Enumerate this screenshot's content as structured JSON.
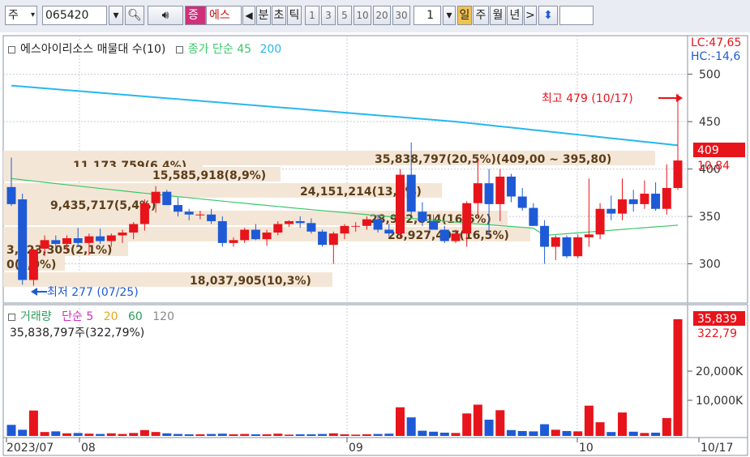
{
  "toolbar": {
    "period_select": "주",
    "code": "065420",
    "stock_badge": "증",
    "stock_name": "에스",
    "nav_left": "◀",
    "buttons": [
      "분",
      "초",
      "틱"
    ],
    "intervals": [
      "1",
      "3",
      "5",
      "10",
      "20",
      "30"
    ],
    "count": "1",
    "tf_buttons": [
      "일",
      "주",
      "월",
      "년"
    ],
    "nav_right": ">",
    "updown": "⬍"
  },
  "price_legend": {
    "name": "에스아이리소스 매물대 수(10)",
    "ma_label": "종가 단순 45",
    "ma_value": "200"
  },
  "right_top": {
    "lc": "LC:47,65",
    "hc": "HC:-14,6"
  },
  "y_axis": {
    "ticks": [
      "500",
      "450",
      "400",
      "350",
      "300"
    ]
  },
  "current_price": {
    "value": "409",
    "change": "10,84"
  },
  "annotations": {
    "high": "최고 479 (10/17)",
    "low": "최저 277 (07/25)"
  },
  "volume_profile": [
    {
      "label": "35,838,797(20,5%)(409,00 ~ 395,80)"
    },
    {
      "label": "11,173,759(6,4%)"
    },
    {
      "label": "15,585,918(8,9%)"
    },
    {
      "label": "24,151,214(13,8%)"
    },
    {
      "label": "9,435,717(5,4%)"
    },
    {
      "label": "28,952,814(16,6%)"
    },
    {
      "label": "28,927,407(16,5%)"
    },
    {
      "label": "3,723,305(2,1%)"
    },
    {
      "label": "0(0,0%)"
    },
    {
      "label": "18,037,905(10,3%)"
    }
  ],
  "volume_legend": {
    "name": "거래량",
    "ma_label": "단순",
    "ma_values": [
      "5",
      "20",
      "60",
      "120"
    ],
    "current": "35,838,797주(322,79%)"
  },
  "vol_axis": {
    "ticks": [
      "20,000K",
      "10,000K"
    ],
    "current": "35,839",
    "pct": "322,79"
  },
  "x_axis": {
    "labels": [
      "2023/07",
      "08",
      "09",
      "10",
      "10/17"
    ]
  },
  "colors": {
    "up": "#e8141b",
    "down": "#1e5ad6",
    "ma": "#39c86a",
    "ma200": "#27b7ee",
    "profile": "#f4e6d6"
  },
  "chart_data": {
    "type": "candlestick",
    "x": [
      "07/17",
      "07/18",
      "07/19",
      "07/20",
      "07/21",
      "07/24",
      "07/25",
      "07/26",
      "07/27",
      "07/28",
      "07/31",
      "08/01",
      "08/02",
      "08/03",
      "08/04",
      "08/07",
      "08/08",
      "08/09",
      "08/10",
      "08/11",
      "08/14",
      "08/16",
      "08/17",
      "08/18",
      "08/21",
      "08/22",
      "08/23",
      "08/24",
      "08/25",
      "08/28",
      "08/29",
      "08/30",
      "08/31",
      "09/01",
      "09/04",
      "09/05",
      "09/06",
      "09/07",
      "09/08",
      "09/11",
      "09/12",
      "09/13",
      "09/14",
      "09/15",
      "09/18",
      "09/19",
      "09/20",
      "09/21",
      "09/22",
      "09/25",
      "09/26",
      "09/27",
      "10/04",
      "10/05",
      "10/06",
      "10/10",
      "10/11",
      "10/12",
      "10/13",
      "10/16",
      "10/17"
    ],
    "ohlc": [
      [
        381,
        412,
        361,
        363
      ],
      [
        368,
        374,
        278,
        283
      ],
      [
        283,
        316,
        277,
        315
      ],
      [
        316,
        330,
        308,
        325
      ],
      [
        325,
        330,
        316,
        321
      ],
      [
        321,
        330,
        314,
        327
      ],
      [
        327,
        338,
        318,
        322
      ],
      [
        322,
        332,
        309,
        329
      ],
      [
        329,
        337,
        321,
        324
      ],
      [
        324,
        332,
        318,
        330
      ],
      [
        330,
        336,
        322,
        333
      ],
      [
        333,
        344,
        326,
        342
      ],
      [
        342,
        368,
        335,
        364
      ],
      [
        364,
        382,
        354,
        376
      ],
      [
        376,
        378,
        362,
        362
      ],
      [
        362,
        370,
        350,
        355
      ],
      [
        355,
        358,
        346,
        352
      ],
      [
        352,
        356,
        347,
        352
      ],
      [
        352,
        358,
        342,
        345
      ],
      [
        345,
        350,
        318,
        322
      ],
      [
        322,
        328,
        318,
        325
      ],
      [
        325,
        338,
        322,
        336
      ],
      [
        336,
        342,
        325,
        326
      ],
      [
        326,
        336,
        319,
        333
      ],
      [
        333,
        345,
        330,
        342
      ],
      [
        342,
        346,
        339,
        345
      ],
      [
        345,
        350,
        338,
        343
      ],
      [
        343,
        348,
        332,
        334
      ],
      [
        334,
        336,
        318,
        320
      ],
      [
        320,
        334,
        300,
        332
      ],
      [
        332,
        342,
        326,
        340
      ],
      [
        340,
        344,
        334,
        340
      ],
      [
        340,
        350,
        336,
        347
      ],
      [
        347,
        352,
        333,
        336
      ],
      [
        336,
        342,
        329,
        332
      ],
      [
        332,
        400,
        328,
        394
      ],
      [
        394,
        428,
        350,
        355
      ],
      [
        355,
        365,
        340,
        345
      ],
      [
        345,
        352,
        336,
        336
      ],
      [
        336,
        340,
        322,
        324
      ],
      [
        324,
        336,
        322,
        332
      ],
      [
        332,
        366,
        318,
        364
      ],
      [
        364,
        410,
        348,
        385
      ],
      [
        385,
        400,
        330,
        363
      ],
      [
        363,
        400,
        345,
        392
      ],
      [
        392,
        395,
        365,
        371
      ],
      [
        371,
        380,
        356,
        359
      ],
      [
        359,
        364,
        340,
        340
      ],
      [
        340,
        346,
        300,
        318
      ],
      [
        318,
        330,
        304,
        328
      ],
      [
        328,
        330,
        306,
        308
      ],
      [
        308,
        331,
        306,
        328
      ],
      [
        328,
        390,
        318,
        331
      ],
      [
        331,
        364,
        326,
        358
      ],
      [
        358,
        372,
        346,
        353
      ],
      [
        353,
        390,
        346,
        368
      ],
      [
        368,
        378,
        355,
        363
      ],
      [
        363,
        388,
        358,
        374
      ],
      [
        374,
        386,
        356,
        358
      ],
      [
        358,
        405,
        352,
        380
      ],
      [
        380,
        479,
        378,
        409
      ]
    ],
    "volume_k": [
      3400,
      1900,
      7800,
      1200,
      1400,
      800,
      900,
      700,
      600,
      800,
      600,
      900,
      1800,
      1200,
      800,
      600,
      500,
      500,
      600,
      700,
      500,
      600,
      500,
      500,
      700,
      400,
      500,
      500,
      600,
      800,
      500,
      400,
      500,
      600,
      700,
      8800,
      5700,
      1600,
      1300,
      1000,
      900,
      6900,
      9600,
      5000,
      7900,
      1800,
      1500,
      1400,
      3600,
      1900,
      1500,
      1400,
      9300,
      4200,
      1200,
      7200,
      1300,
      900,
      1000,
      5500,
      35839
    ],
    "ylim": [
      270,
      510
    ],
    "ma200_label": "200",
    "ma45_label": "종가 단순 45"
  }
}
